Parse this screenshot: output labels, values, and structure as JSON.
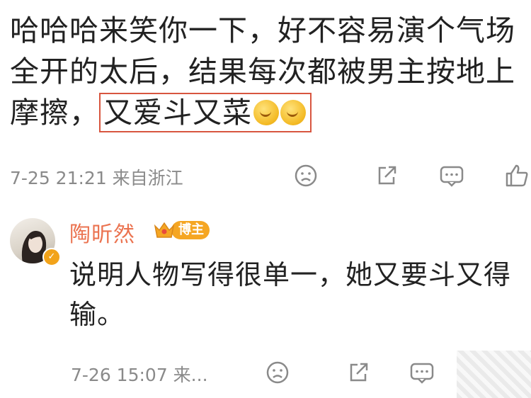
{
  "comment1": {
    "text": "哈哈哈来笑你一下，好不容易演个气场全开的太后，结果每次都被男主按地上摩擦，",
    "highlight": "又爱斗又菜",
    "emoji": "smirk-emoji",
    "time": "7-25 21:21 来自浙江"
  },
  "reply": {
    "username": "陶昕然",
    "badge": "博主",
    "text": "说明人物写得很单一，她又要斗又得输。",
    "time": "7-26 15:07 来..."
  },
  "actions": [
    "frown-icon",
    "share-icon",
    "comment-icon",
    "like-icon"
  ],
  "colors": {
    "highlight_border": "#d8553f",
    "username": "#eb7350",
    "badge": "#f5a623",
    "meta": "#8a8a8a"
  }
}
